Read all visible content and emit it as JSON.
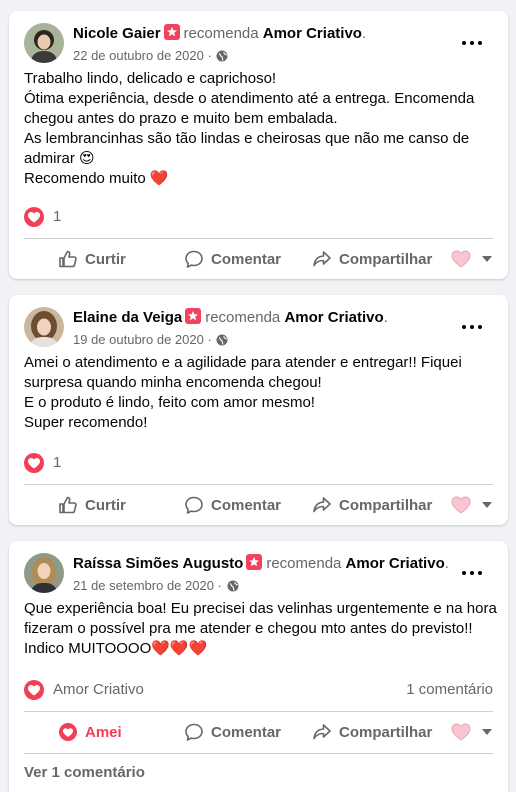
{
  "posts": [
    {
      "author": "Nicole Gaier",
      "recommends_text": "recomenda",
      "page_name": "Amor Criativo",
      "date": "22 de outubro de 2020",
      "body_lines": [
        "Trabalho lindo, delicado e caprichoso!",
        "Ótima experiência, desde o atendimento até a entrega. Encomenda",
        "chegou antes do prazo e muito bem embalada.",
        "As lembrancinhas são tão lindas e cheirosas que não me canso de",
        "admirar 😍",
        "Recomendo muito ❤️"
      ],
      "reaction_count": "1",
      "actions": {
        "like": "Curtir",
        "comment": "Comentar",
        "share": "Compartilhar"
      }
    },
    {
      "author": "Elaine da Veiga",
      "recommends_text": "recomenda",
      "page_name": "Amor Criativo",
      "date": "19 de outubro de 2020",
      "body_lines": [
        "Amei o atendimento e a agilidade para atender e entregar!! Fiquei",
        "surpresa quando minha encomenda chegou!",
        "E o produto é lindo, feito com amor mesmo!",
        "Super recomendo!"
      ],
      "reaction_count": "1",
      "actions": {
        "like": "Curtir",
        "comment": "Comentar",
        "share": "Compartilhar"
      }
    },
    {
      "author": "Raíssa Simões Augusto",
      "recommends_text": "recomenda",
      "page_name": "Amor Criativo",
      "date": "21 de setembro de 2020",
      "body_lines": [
        "Que experiência boa! Eu precisei das velinhas urgentemente e na hora",
        "fizeram o possível pra me atender e chegou mto antes do previsto!!",
        "Indico MUITOOOO❤️❤️❤️"
      ],
      "reaction_name": "Amor Criativo",
      "comments_count": "1 comentário",
      "actions": {
        "like": "Amei",
        "comment": "Comentar",
        "share": "Compartilhar"
      },
      "view_comments": "Ver 1 comentário"
    }
  ],
  "colors": {
    "love": "#f33e58",
    "recommend_badge": "#f3425f",
    "muted": "#65676b",
    "text": "#050505"
  },
  "icons": [
    "more-icon",
    "globe-icon",
    "recommend-badge-icon",
    "heart-reaction-icon",
    "like-icon",
    "comment-icon",
    "share-icon",
    "reaction-selector-icon"
  ]
}
